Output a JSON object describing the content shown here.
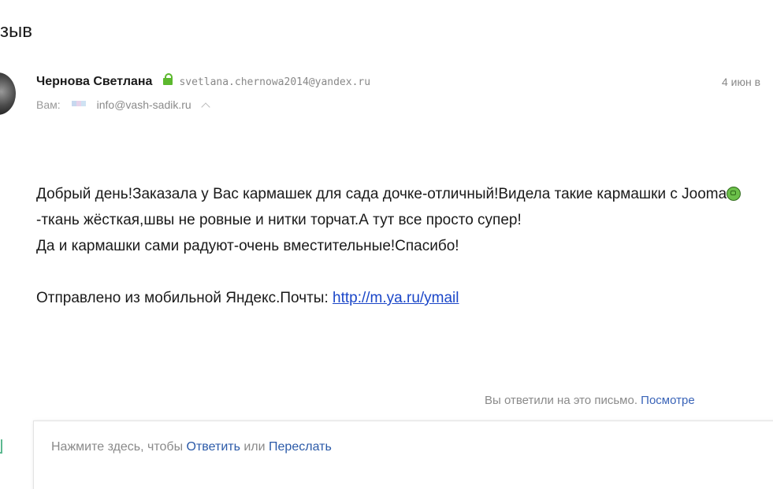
{
  "mail": {
    "subject_partial": "зыв",
    "sender": {
      "name": "Чернова Светлана",
      "email": "svetlana.chernowa2014@yandex.ru",
      "date": "4 июн в"
    },
    "recipient": {
      "label": "Вам:",
      "email": "info@vash-sadik.ru"
    },
    "body": {
      "p1_part1": "Добрый день!Заказала у Вас кармашек для сада дочке-отличный!Видела такие кармашки с Jooma",
      "p1_part2": "-ткань жёсткая,швы не ровные и нитки торчат.А тут все просто супер!",
      "p2": "Да и кармашки сами радуют-очень вместительные!Спасибо!",
      "signature_text": "Отправлено из мобильной Яндекс.Почты: ",
      "signature_link": "http://m.ya.ru/ymail"
    },
    "replied": {
      "text": "Вы ответили на это письмо. ",
      "link": "Посмотре"
    },
    "quick_reply": {
      "prefix": "Нажмите здесь, чтобы ",
      "reply": "Ответить",
      "or": " или ",
      "forward": "Переслать"
    }
  },
  "icons": {
    "lock": "lock-icon",
    "recipient_flag": "flag-icon",
    "collapse": "chevron-up-icon",
    "emoji": "emoji-icon",
    "reply": "reply-icon"
  },
  "colors": {
    "lock": "#5cb82e",
    "link": "#1a46c8",
    "action": "#2b5aa8",
    "muted": "#8a8a8a"
  }
}
